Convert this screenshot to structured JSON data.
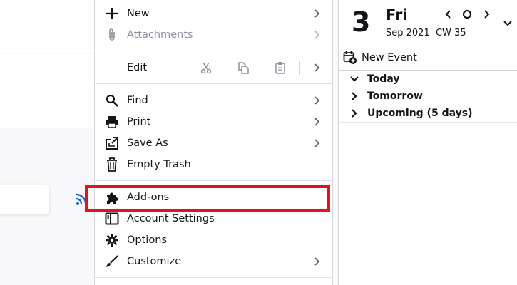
{
  "app_menu": {
    "items": [
      {
        "key": "new",
        "label": "New",
        "icon": "plus-icon",
        "has_submenu": true,
        "disabled": false
      },
      {
        "key": "attachments",
        "label": "Attachments",
        "icon": "paperclip-icon",
        "has_submenu": true,
        "disabled": true
      },
      {
        "key": "edit",
        "label": "Edit",
        "has_submenu": true,
        "tools": [
          "cut-icon",
          "copy-icon",
          "paste-icon"
        ]
      },
      {
        "key": "find",
        "label": "Find",
        "icon": "search-icon",
        "has_submenu": true
      },
      {
        "key": "print",
        "label": "Print",
        "icon": "printer-icon",
        "has_submenu": true
      },
      {
        "key": "save_as",
        "label": "Save As",
        "icon": "save-as-icon",
        "has_submenu": true
      },
      {
        "key": "empty_trash",
        "label": "Empty Trash",
        "icon": "trash-icon",
        "has_submenu": false
      },
      {
        "key": "addons",
        "label": "Add-ons",
        "icon": "puzzle-icon",
        "has_submenu": false,
        "highlighted": true
      },
      {
        "key": "account_settings",
        "label": "Account Settings",
        "icon": "account-settings-icon",
        "has_submenu": false
      },
      {
        "key": "options",
        "label": "Options",
        "icon": "gear-icon",
        "has_submenu": false
      },
      {
        "key": "customize",
        "label": "Customize",
        "icon": "brush-icon",
        "has_submenu": true
      }
    ],
    "highlight_color": "#e0141e"
  },
  "calendar_pane": {
    "day_number": "3",
    "day_name": "Fri",
    "month_year": "Sep 2021",
    "week": "CW 35",
    "new_event_label": "New Event",
    "groups": [
      {
        "label": "Today",
        "expanded": true
      },
      {
        "label": "Tomorrow",
        "expanded": false
      },
      {
        "label": "Upcoming (5 days)",
        "expanded": false
      }
    ]
  },
  "colors": {
    "accent_blue": "#0060df",
    "highlight_red": "#e0141e",
    "text": "#15141a",
    "muted": "#8f8f9d"
  }
}
